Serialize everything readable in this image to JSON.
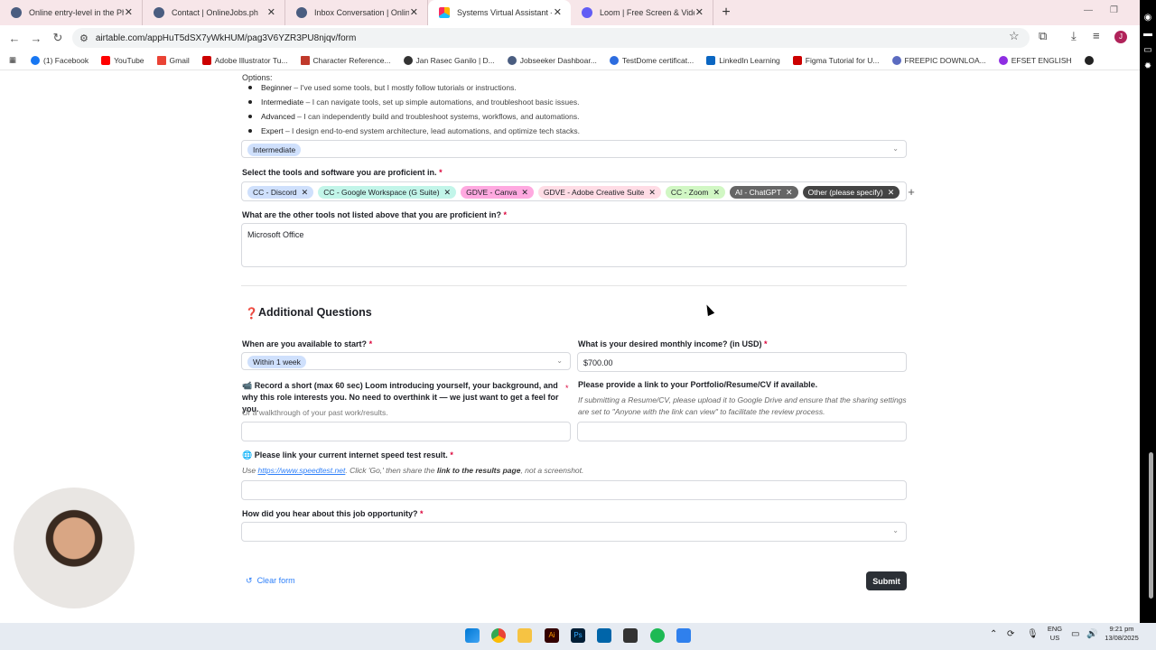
{
  "browser": {
    "tabs": [
      {
        "title": "Online entry-level in the Philipp",
        "icon": "globe-icon",
        "active": false
      },
      {
        "title": "Contact | OnlineJobs.ph",
        "icon": "globe-icon",
        "active": false
      },
      {
        "title": "Inbox Conversation | OnlineJob",
        "icon": "globe-icon",
        "active": false
      },
      {
        "title": "Systems Virtual Assistant - Airt",
        "icon": "airtable-icon",
        "active": true
      },
      {
        "title": "Loom | Free Screen & Video Re",
        "icon": "loom-icon",
        "active": false
      }
    ],
    "url": "airtable.com/appHuT5dSX7yWkHUM/pag3V6YZR3PU8njqv/form",
    "avatar_letter": "J",
    "bookmarks": [
      {
        "label": "(1) Facebook",
        "color": "#1877f2"
      },
      {
        "label": "YouTube",
        "color": "#ff0000"
      },
      {
        "label": "Gmail",
        "color": "#ea4335"
      },
      {
        "label": "Adobe Illustrator Tu...",
        "color": "#cc0000"
      },
      {
        "label": "Character Reference...",
        "color": "#c0392b"
      },
      {
        "label": "Jan Rasec Ganilo | D...",
        "color": "#333333"
      },
      {
        "label": "Jobseeker Dashboar...",
        "color": "#4a5d80"
      },
      {
        "label": "TestDome certificat...",
        "color": "#2d6cdf"
      },
      {
        "label": "LinkedIn Learning",
        "color": "#0a66c2"
      },
      {
        "label": "Figma Tutorial for U...",
        "color": "#cc0000"
      },
      {
        "label": "FREEPIC DOWNLOA...",
        "color": "#5b6bc0"
      },
      {
        "label": "EFSET ENGLISH",
        "color": "#8e2de2"
      }
    ]
  },
  "form": {
    "options_label": "Options:",
    "levels": [
      {
        "name": "Beginner",
        "desc": " – I've used some tools, but I mostly follow tutorials or instructions."
      },
      {
        "name": "Intermediate",
        "desc": " – I can navigate tools, set up simple automations, and troubleshoot basic issues."
      },
      {
        "name": "Advanced",
        "desc": " – I can independently build and troubleshoot systems, workflows, and automations."
      },
      {
        "name": "Expert",
        "desc": " – I design end-to-end system architecture, lead automations, and optimize tech stacks."
      }
    ],
    "level_selected": "Intermediate",
    "tools_label": "Select the tools and software you are proficient in.",
    "tools": [
      {
        "label": "CC - Discord",
        "color": "#cfe0fc"
      },
      {
        "label": "CC - Google Workspace (G Suite)",
        "color": "#c2f5e9"
      },
      {
        "label": "GDVE - Canva",
        "color": "#ffa9e0"
      },
      {
        "label": "GDVE - Adobe Creative Suite",
        "color": "#ffdce5"
      },
      {
        "label": "CC - Zoom",
        "color": "#d1f7c4"
      },
      {
        "label": "AI - ChatGPT",
        "color": "#666666"
      },
      {
        "label": "Other (please specify)",
        "color": "#444444"
      }
    ],
    "other_tools_label": "What are the other tools not listed above that you are proficient in?",
    "other_tools_value": "Microsoft Office",
    "section_title": "Additional Questions",
    "start_label": "When are you available to start?",
    "start_value": "Within 1 week",
    "income_label": "What is your desired monthly income? (in USD)",
    "income_value": "$700.00",
    "loom_label": "Record a short (max 60 sec) Loom introducing yourself, your background, and why this role interests you. No need to overthink it — we just want to get a feel for you.",
    "loom_help": "Or a walkthrough of your past work/results.",
    "portfolio_label": "Please provide a link to your Portfolio/Resume/CV if available.",
    "portfolio_help": "If submitting a Resume/CV, please upload it to Google Drive and ensure that the sharing settings are set to \"Anyone with the link can view\" to facilitate the review process.",
    "speed_label": "Please link your current internet speed test result.",
    "speed_help_prefix": "Use ",
    "speed_help_link": "https://www.speedtest.net",
    "speed_help_mid": ". Click 'Go,' then share the ",
    "speed_help_bold": "link to the results page",
    "speed_help_suffix": ", not a screenshot.",
    "source_label": "How did you hear about this job opportunity?",
    "clear_label": "Clear form",
    "submit_label": "Submit",
    "required_mark": "*"
  },
  "taskbar": {
    "lang": "ENG",
    "region": "US",
    "time": "9:21 pm",
    "date": "13/08/2025"
  }
}
